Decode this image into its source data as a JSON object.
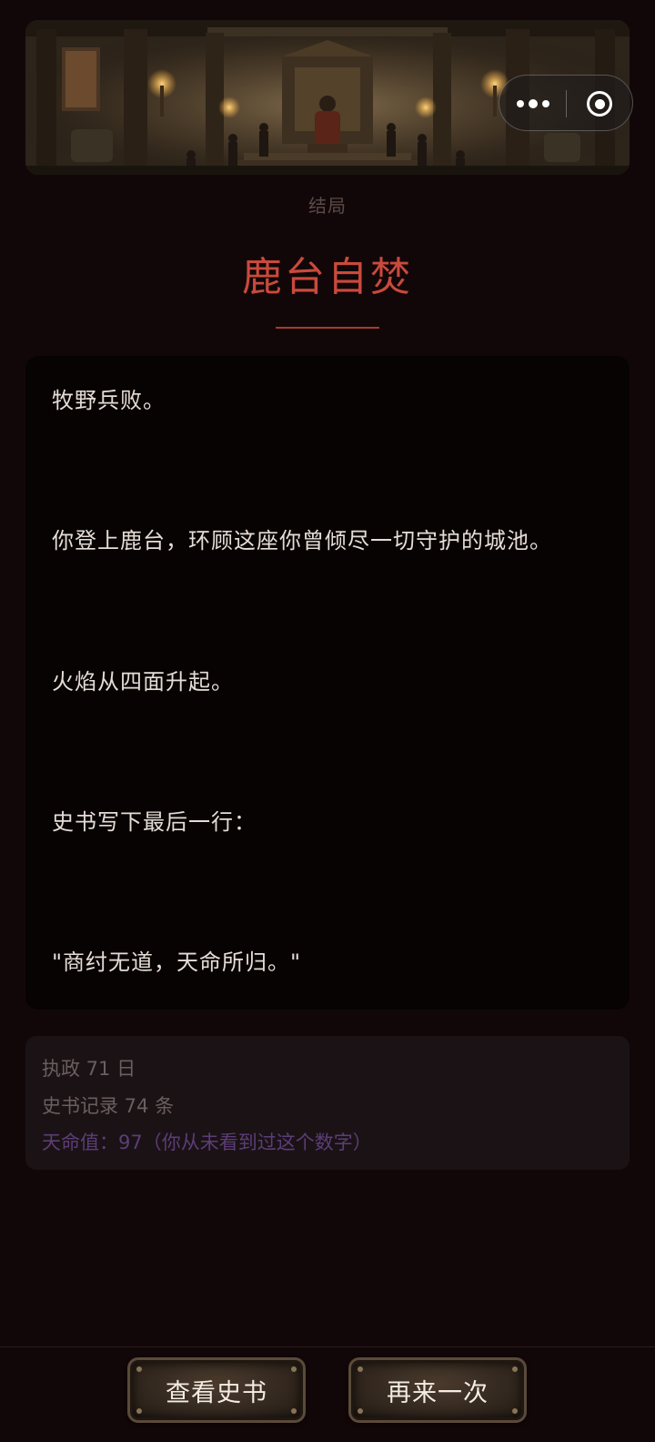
{
  "banner": {
    "image_label": "palace-throne-hall"
  },
  "capsule": {
    "more_icon": "more-dots-icon",
    "close_icon": "target-circle-icon"
  },
  "ending": {
    "kicker": "结局",
    "title": "鹿台自焚"
  },
  "story": {
    "lines": [
      "牧野兵败。",
      "你登上鹿台，环顾这座你曾倾尽一切守护的城池。",
      "火焰从四面升起。",
      "史书写下最后一行：",
      "\"商纣无道，天命所归。\""
    ]
  },
  "stats": {
    "days": "执政 71 日",
    "records": "史书记录 74 条",
    "fate": "天命值：97（你从未看到过这个数字）"
  },
  "actions": {
    "view_history": "查看史书",
    "retry": "再来一次"
  },
  "colors": {
    "background": "#120708",
    "title": "#c94a3c",
    "fate_text": "#5c3d78"
  }
}
